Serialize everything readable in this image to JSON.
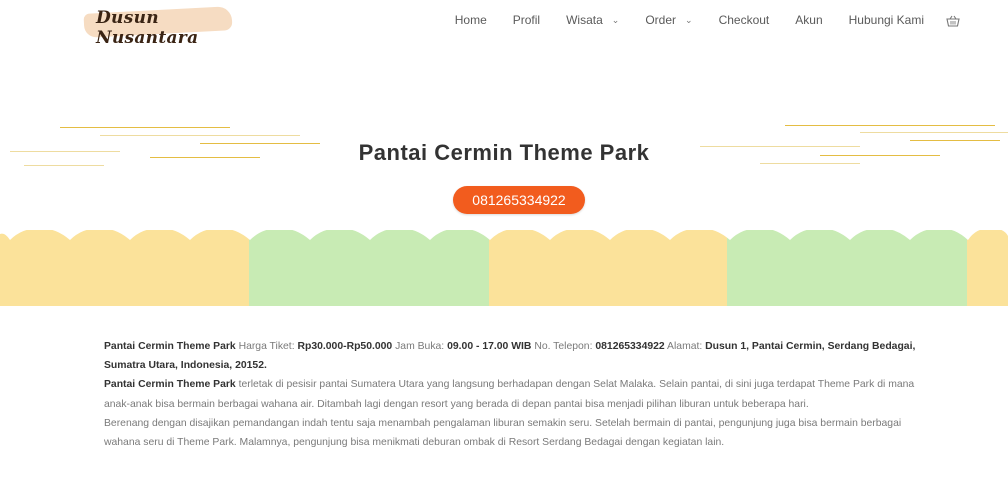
{
  "brand": {
    "name": "Dusun Nusantara"
  },
  "nav": {
    "items": [
      {
        "label": "Home"
      },
      {
        "label": "Profil"
      },
      {
        "label": "Wisata",
        "dropdown": true
      },
      {
        "label": "Order",
        "dropdown": true
      },
      {
        "label": "Checkout"
      },
      {
        "label": "Akun"
      },
      {
        "label": "Hubungi Kami"
      }
    ],
    "cart_icon": "basket-icon"
  },
  "hero": {
    "title": "Pantai Cermin Theme Park",
    "phone": "081265334922"
  },
  "colors": {
    "accent": "#f25c1e",
    "wave_yellow": "#fbe29a",
    "wave_green": "#c8ebb4",
    "line_gold": "#e4bd43"
  },
  "content": {
    "info": {
      "name": "Pantai Cermin Theme Park",
      "harga_label": "Harga Tiket:",
      "harga_value": "Rp30.000-Rp50.000",
      "jam_label": "Jam Buka:",
      "jam_value": "09.00 - 17.00 WIB",
      "telepon_label": "No. Telepon:",
      "telepon_value": "081265334922",
      "alamat_label": "Alamat:",
      "alamat_value": "Dusun 1, Pantai Cermin, Serdang Bedagai, Sumatra Utara, Indonesia, 20152."
    },
    "para1_name": "Pantai Cermin Theme Park",
    "para1_text": "terletak di pesisir pantai Sumatera Utara yang langsung berhadapan dengan Selat Malaka. Selain pantai, di sini juga terdapat Theme Park di mana anak-anak bisa bermain berbagai wahana air. Ditambah lagi dengan resort yang berada di depan pantai bisa menjadi pilihan liburan untuk beberapa hari.",
    "para2_text": "Berenang dengan disajikan pemandangan indah tentu saja menambah pengalaman liburan semakin seru. Setelah bermain di pantai, pengunjung juga bisa bermain berbagai wahana seru di Theme Park. Malamnya, pengunjung bisa menikmati deburan ombak di Resort Serdang Bedagai dengan kegiatan lain."
  }
}
